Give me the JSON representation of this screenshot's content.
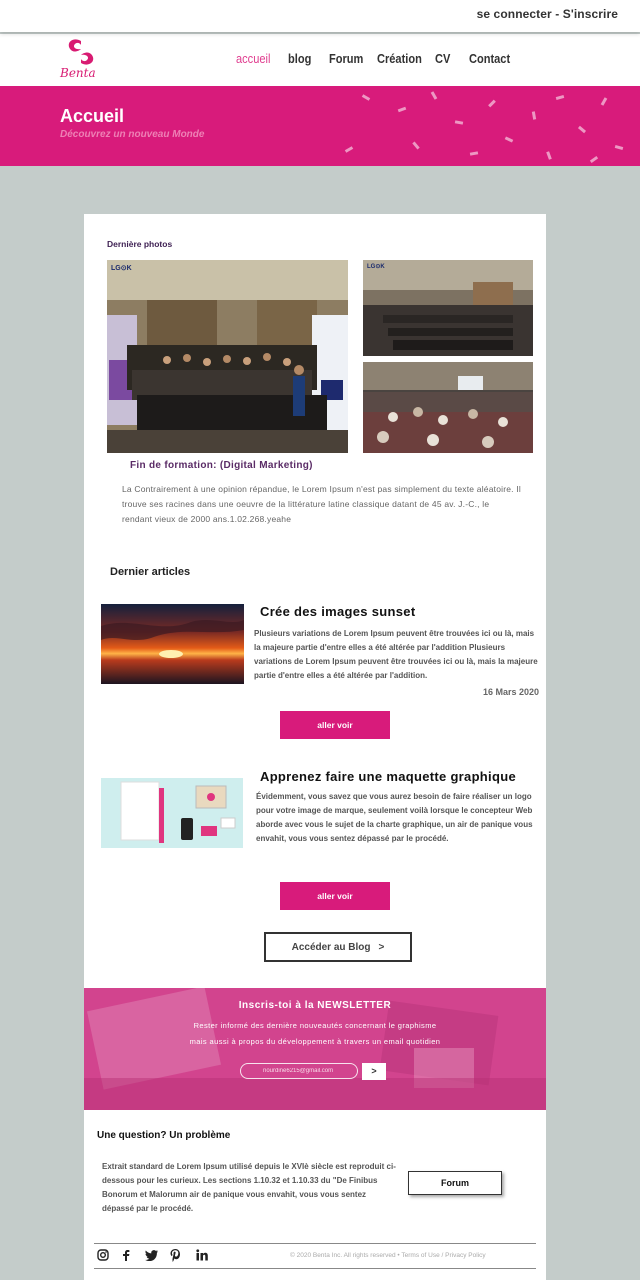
{
  "topbar": {
    "auth_link": "se connecter - S'inscrire"
  },
  "brand": {
    "name": "Benta"
  },
  "nav": {
    "items": [
      "accueil",
      "blog",
      "Forum",
      "Création",
      "CV",
      "Contact"
    ],
    "active": "accueil"
  },
  "hero": {
    "title": "Accueil",
    "subtitle": "Découvrez un nouveau Monde"
  },
  "photos": {
    "section_title": "Dernière photos",
    "caption": "Fin de formation: (Digital Marketing)",
    "description": "La Contrairement à une opinion répandue, le Lorem Ipsum n'est pas simplement du texte aléatoire. Il trouve ses racines dans une oeuvre de la littérature latine classique datant de 45 av. J.-C., le rendant vieux de 2000 ans.1.02.268.yeahe",
    "logo_text": "LG⊙K"
  },
  "articles": {
    "section_title": "Dernier articles",
    "items": [
      {
        "title": "Crée des images sunset",
        "text": "Plusieurs variations de Lorem Ipsum peuvent être trouvées ici ou là, mais la majeure partie d'entre elles a été altérée par l'addition Plusieurs variations de Lorem Ipsum peuvent être trouvées ici ou là, mais la majeure partie d'entre elles a été altérée par l'addition.",
        "date": "16 Mars 2020",
        "button": "aller voir"
      },
      {
        "title": "Apprenez faire une maquette graphique",
        "text": "Évidemment, vous savez que vous aurez besoin de faire réaliser un logo pour votre image de marque, seulement voilà lorsque le concepteur Web aborde avec vous le sujet de la charte graphique, un air de panique vous envahit, vous vous sentez dépassé par le procédé.",
        "button": "aller voir"
      }
    ],
    "blog_button": "Accéder au Blog",
    "blog_arrow": ">"
  },
  "newsletter": {
    "title": "Inscris-toi à la NEWSLETTER",
    "text": "Rester informé des dernière nouveautés concernant le graphisme mais aussi à propos du développement à travers un email quotidien",
    "input_placeholder": "nourdine6215@gmail.com",
    "submit": ">"
  },
  "support": {
    "title": "Une question? Un problème",
    "text": "Extrait standard de Lorem Ipsum utilisé depuis le XVIè siècle est reproduit ci-dessous pour les curieux. Les sections 1.10.32 et 1.10.33 du \"De Finibus Bonorum et Malorumn air de panique vous envahit, vous vous sentez dépassé par le procédé.",
    "button": "Forum"
  },
  "footer": {
    "copyright": "© 2020 Benta Inc. All rights reserved",
    "separator": "•",
    "terms": "Terms of Use",
    "slash": "/",
    "privacy": "Privacy Policy",
    "social_icons": [
      "instagram-icon",
      "facebook-icon",
      "twitter-icon",
      "pinterest-icon",
      "linkedin-icon"
    ]
  },
  "colors": {
    "brand_pink": "#d81b7b",
    "active_nav": "#e03d8f",
    "background": "#c4ccca",
    "caption_purple": "#5a2b66"
  }
}
